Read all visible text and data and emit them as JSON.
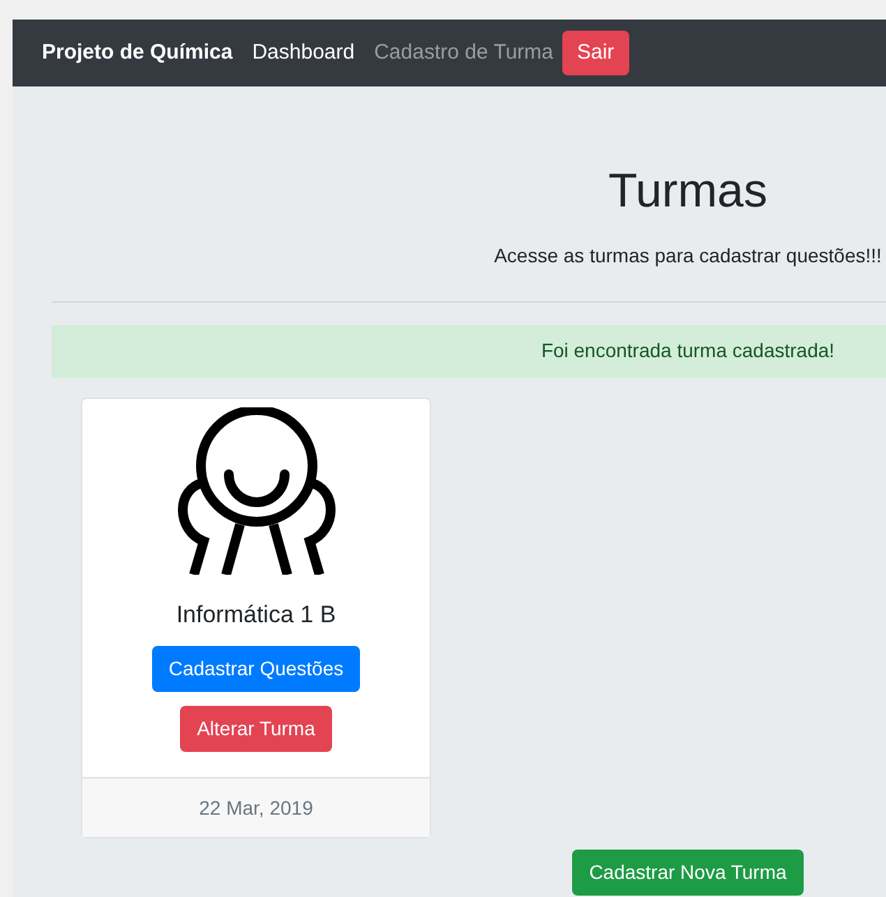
{
  "navbar": {
    "brand": "Projeto de Química",
    "links": [
      {
        "label": "Dashboard",
        "selected": true
      },
      {
        "label": "Cadastro de Turma",
        "selected": false
      }
    ],
    "logout_button": "Sair"
  },
  "header": {
    "title": "Turmas",
    "subtitle": "Acesse as turmas para cadastrar questões!!!"
  },
  "alert": "Foi encontrada turma cadastrada!",
  "cards": [
    {
      "title": "Informática 1 B",
      "buttons": [
        {
          "label": "Cadastrar Questões",
          "kind": "primary"
        },
        {
          "label": "Alterar Turma",
          "kind": "danger"
        }
      ],
      "footer": "22 Mar, 2019"
    }
  ],
  "new_button": "Cadastrar Nova Turma"
}
